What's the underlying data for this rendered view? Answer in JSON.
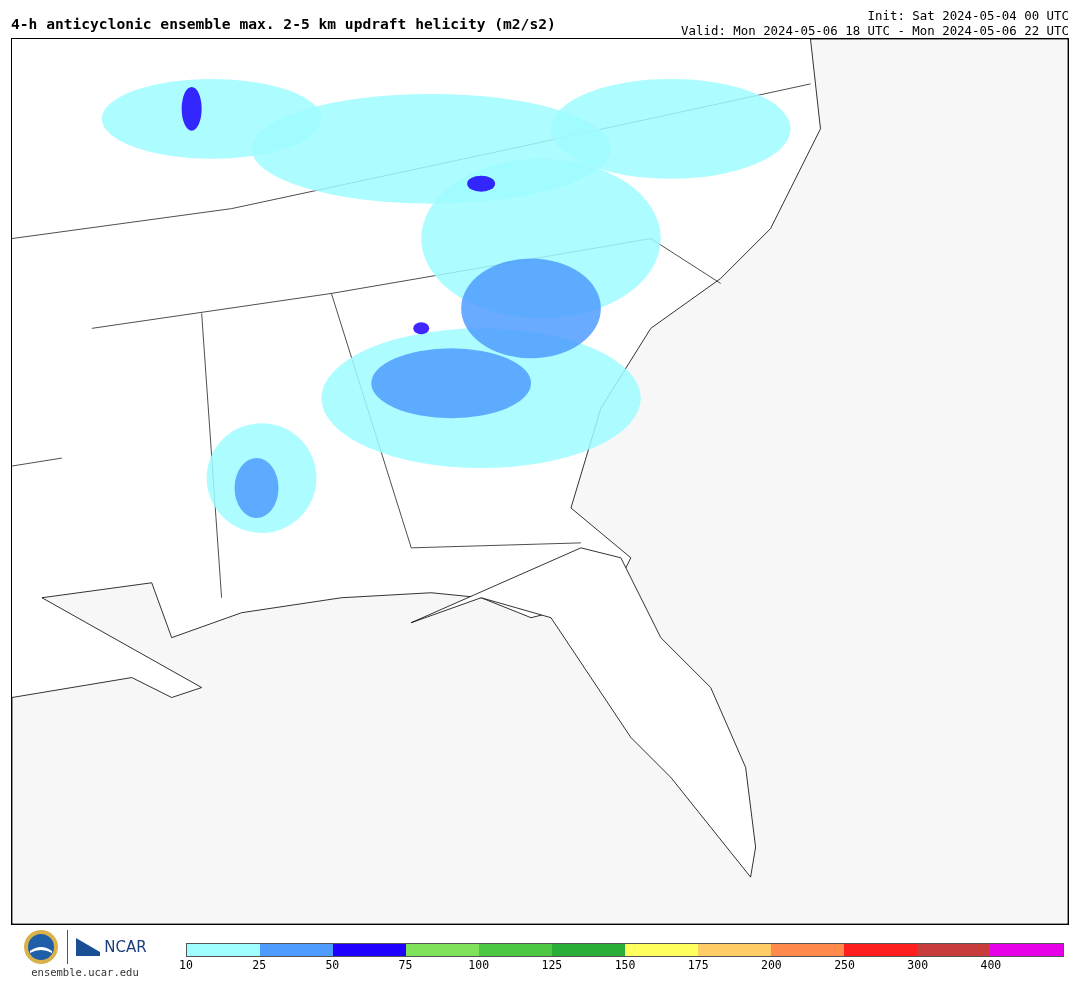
{
  "header": {
    "title": "4-h anticyclonic ensemble max. 2-5 km updraft helicity (m2/s2)",
    "init": "Init: Sat 2024-05-04 00 UTC",
    "valid": "Valid: Mon 2024-05-06 18 UTC - Mon 2024-05-06 22 UTC"
  },
  "footer": {
    "logo_text": "NCAR",
    "site": "ensemble.ucar.edu"
  },
  "colorbar": {
    "segments": [
      {
        "color": "#9ffcff",
        "label": "10"
      },
      {
        "color": "#4f9cff",
        "label": "25"
      },
      {
        "color": "#1e00ff",
        "label": "50"
      },
      {
        "color": "#7ee35a",
        "label": "75"
      },
      {
        "color": "#4cc843",
        "label": "100"
      },
      {
        "color": "#2aae38",
        "label": "125"
      },
      {
        "color": "#ffff5e",
        "label": "150"
      },
      {
        "color": "#ffcc66",
        "label": "175"
      },
      {
        "color": "#ff8a4b",
        "label": "200"
      },
      {
        "color": "#ff1e1e",
        "label": "250"
      },
      {
        "color": "#c83c3c",
        "label": "300"
      },
      {
        "color": "#e800e8",
        "label": "400"
      }
    ]
  }
}
